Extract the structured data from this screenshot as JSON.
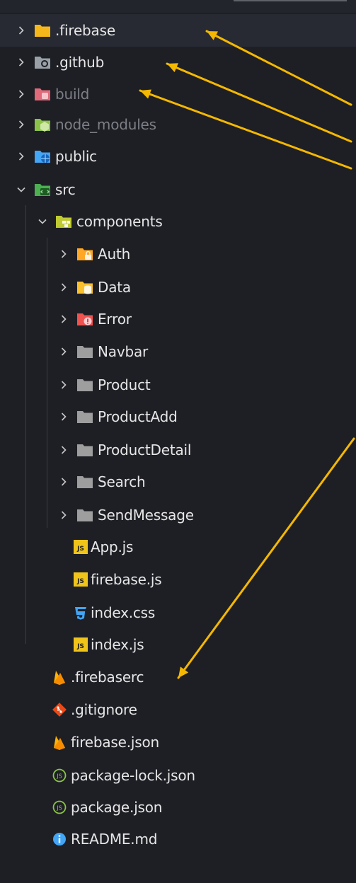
{
  "tree": {
    "items": [
      {
        "label": ".firebase",
        "kind": "folder",
        "icon": "firebase-folder-icon",
        "color": "#f6b71b",
        "expanded": false
      },
      {
        "label": ".github",
        "kind": "folder",
        "icon": "github-folder-icon",
        "color": "#9aa0a8",
        "expanded": false
      },
      {
        "label": "build",
        "kind": "folder",
        "icon": "build-folder-icon",
        "color": "#e06a7a",
        "expanded": false,
        "dimmed": true
      },
      {
        "label": "node_modules",
        "kind": "folder",
        "icon": "node-folder-icon",
        "color": "#8bc34a",
        "expanded": false,
        "dimmed": true
      },
      {
        "label": "public",
        "kind": "folder",
        "icon": "public-folder-icon",
        "color": "#42a5f5",
        "expanded": false
      },
      {
        "label": "src",
        "kind": "folder",
        "icon": "src-folder-icon",
        "color": "#4caf50",
        "expanded": true
      },
      {
        "label": "components",
        "kind": "folder",
        "icon": "components-folder-icon",
        "color": "#c0ca33",
        "expanded": true
      },
      {
        "label": "Auth",
        "kind": "folder",
        "icon": "auth-folder-icon",
        "color": "#ffa726",
        "expanded": false
      },
      {
        "label": "Data",
        "kind": "folder",
        "icon": "data-folder-icon",
        "color": "#fbc02d",
        "expanded": false
      },
      {
        "label": "Error",
        "kind": "folder",
        "icon": "error-folder-icon",
        "color": "#ef5350",
        "expanded": false
      },
      {
        "label": "Navbar",
        "kind": "folder",
        "icon": "folder-icon",
        "color": "#9e9e9e",
        "expanded": false
      },
      {
        "label": "Product",
        "kind": "folder",
        "icon": "folder-icon",
        "color": "#9e9e9e",
        "expanded": false
      },
      {
        "label": "ProductAdd",
        "kind": "folder",
        "icon": "folder-icon",
        "color": "#9e9e9e",
        "expanded": false
      },
      {
        "label": "ProductDetail",
        "kind": "folder",
        "icon": "folder-icon",
        "color": "#9e9e9e",
        "expanded": false
      },
      {
        "label": "Search",
        "kind": "folder",
        "icon": "folder-icon",
        "color": "#9e9e9e",
        "expanded": false
      },
      {
        "label": "SendMessage",
        "kind": "folder",
        "icon": "folder-icon",
        "color": "#9e9e9e",
        "expanded": false
      },
      {
        "label": "App.js",
        "kind": "file",
        "icon": "js-file-icon",
        "badge": "JS",
        "color": "#f0c419"
      },
      {
        "label": "firebase.js",
        "kind": "file",
        "icon": "js-file-icon",
        "badge": "JS",
        "color": "#f0c419"
      },
      {
        "label": "index.css",
        "kind": "file",
        "icon": "css-file-icon",
        "color": "#42a5f5"
      },
      {
        "label": "index.js",
        "kind": "file",
        "icon": "js-file-icon",
        "badge": "JS",
        "color": "#f0c419"
      },
      {
        "label": ".firebaserc",
        "kind": "file",
        "icon": "firebase-file-icon",
        "color": "#ffb300"
      },
      {
        "label": ".gitignore",
        "kind": "file",
        "icon": "git-file-icon",
        "color": "#e64a19"
      },
      {
        "label": "firebase.json",
        "kind": "file",
        "icon": "firebase-file-icon",
        "color": "#ffb300"
      },
      {
        "label": "package-lock.json",
        "kind": "file",
        "icon": "npm-json-icon",
        "badge": "JS",
        "color": "#8bc34a"
      },
      {
        "label": "package.json",
        "kind": "file",
        "icon": "npm-json-icon",
        "badge": "JS",
        "color": "#8bc34a"
      },
      {
        "label": "README.md",
        "kind": "file",
        "icon": "info-icon",
        "color": "#42a5f5"
      }
    ]
  },
  "annotation": {
    "arrow_color": "#f5b800"
  }
}
